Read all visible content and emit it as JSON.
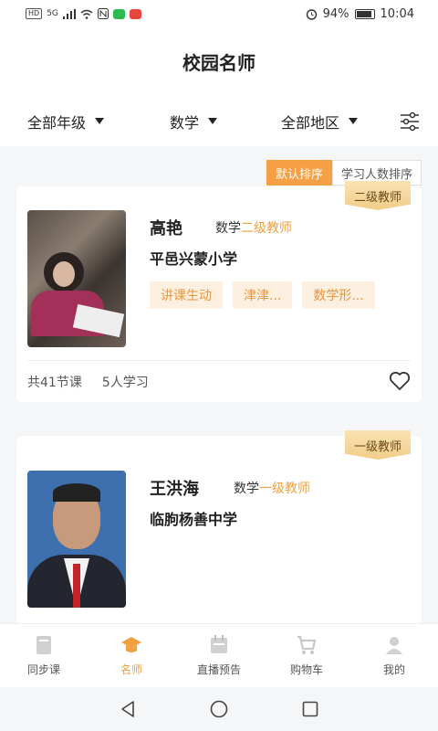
{
  "status_bar": {
    "left_chips": [
      "HD",
      "5G"
    ],
    "battery": "94%",
    "time": "10:04"
  },
  "header": {
    "title": "校园名师"
  },
  "filters": {
    "grade": "全部年级",
    "subject": "数学",
    "region": "全部地区"
  },
  "sort": {
    "default": "默认排序",
    "by_learners": "学习人数排序"
  },
  "teachers": [
    {
      "badge": "二级教师",
      "name": "高艳",
      "subject": "数学",
      "rank": "二级教师",
      "school": "平邑兴蒙小学",
      "tags": [
        "讲课生动",
        "津津...",
        "数学形..."
      ],
      "lessons": "共41节课",
      "learners": "5人学习"
    },
    {
      "badge": "一级教师",
      "name": "王洪海",
      "subject": "数学",
      "rank": "一级教师",
      "school": "临朐杨善中学"
    }
  ],
  "tabbar": [
    {
      "label": "同步课",
      "icon": "book-icon"
    },
    {
      "label": "名师",
      "icon": "graduation-cap-icon"
    },
    {
      "label": "直播预告",
      "icon": "calendar-icon"
    },
    {
      "label": "购物车",
      "icon": "cart-icon"
    },
    {
      "label": "我的",
      "icon": "user-icon"
    }
  ],
  "colors": {
    "accent": "#f0a03c",
    "tag_bg": "#fdf0e0",
    "badge_bg": "#f2cd87"
  }
}
